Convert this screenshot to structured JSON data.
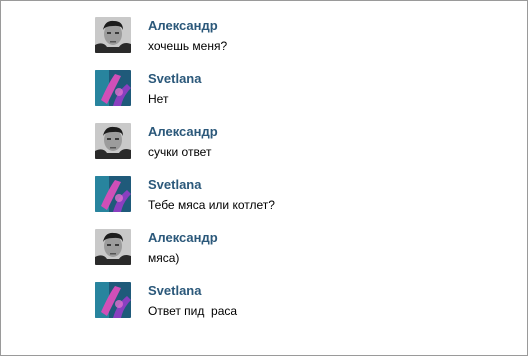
{
  "messages": [
    {
      "author": "Александр",
      "text": "хочешь меня?",
      "avatar": "man-photo"
    },
    {
      "author": "Svetlana",
      "text": "Нет",
      "avatar": "abstract-purple-teal"
    },
    {
      "author": "Александр",
      "text": "сучки ответ",
      "avatar": "man-photo"
    },
    {
      "author": "Svetlana",
      "text": "Тебе мяса или котлет?",
      "avatar": "abstract-purple-teal"
    },
    {
      "author": "Александр",
      "text": "мяса)",
      "avatar": "man-photo"
    },
    {
      "author": "Svetlana",
      "text": "Ответ пид  раса",
      "avatar": "abstract-purple-teal"
    }
  ],
  "colors": {
    "author_link": "#2b587a",
    "message_text": "#000000",
    "frame_border": "#9a9a9a"
  }
}
